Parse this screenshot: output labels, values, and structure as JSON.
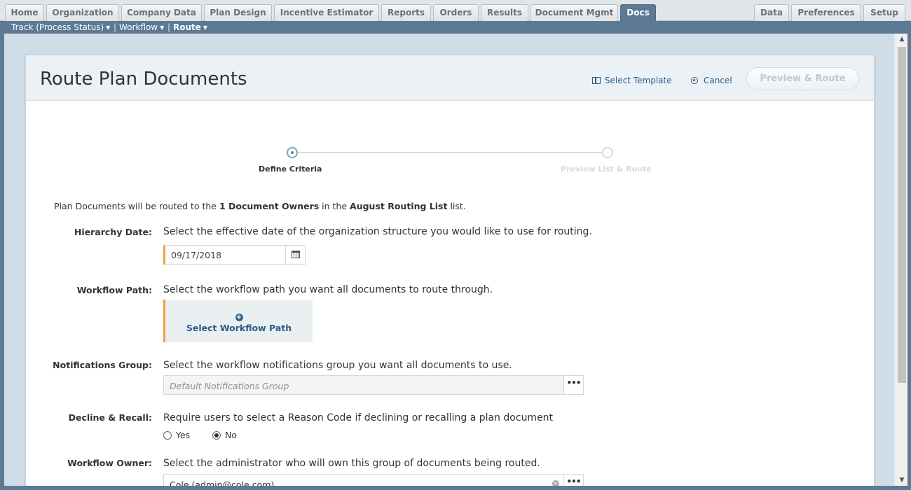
{
  "tabs_left": [
    {
      "label": "Home"
    },
    {
      "label": "Organization"
    },
    {
      "label": "Company Data"
    },
    {
      "label": "Plan Design"
    },
    {
      "label": "Incentive Estimator"
    },
    {
      "label": "Reports"
    },
    {
      "label": "Orders"
    },
    {
      "label": "Results"
    },
    {
      "label": "Document Mgmt"
    },
    {
      "label": "Docs"
    }
  ],
  "tabs_right": [
    {
      "label": "Data"
    },
    {
      "label": "Preferences"
    },
    {
      "label": "Setup"
    }
  ],
  "active_tab": "Docs",
  "subnav": {
    "track": "Track (Process Status)",
    "workflow": "Workflow",
    "route": "Route",
    "separator": "|"
  },
  "header": {
    "title": "Route Plan Documents",
    "select_template": "Select Template",
    "cancel": "Cancel",
    "preview_route": "Preview & Route"
  },
  "stepper": {
    "step1": "Define Criteria",
    "step2": "Preview List & Route"
  },
  "intro": {
    "prefix": "Plan Documents will be routed to the ",
    "owners": "1 Document Owners",
    "middle": " in the ",
    "list": "August Routing List",
    "suffix": " list."
  },
  "hierarchy": {
    "label": "Hierarchy Date:",
    "description": "Select the effective date of the organization structure you would like to use for routing.",
    "value": "09/17/2018"
  },
  "workflow_path": {
    "label": "Workflow Path:",
    "description": "Select the workflow path you want all documents to route through.",
    "button": "Select Workflow Path"
  },
  "notifications": {
    "label": "Notifications Group:",
    "description": "Select the workflow notifications group you want all documents to use.",
    "placeholder": "Default Notifications Group"
  },
  "decline": {
    "label": "Decline & Recall:",
    "description": "Require users to select a Reason Code if declining or recalling a plan document",
    "yes": "Yes",
    "no": "No",
    "selected": "No"
  },
  "workflow_owner": {
    "label": "Workflow Owner:",
    "description": "Select the administrator who will own this group of documents being routed.",
    "value": "Cole (admin@cole.com)"
  },
  "colors": {
    "nav_bar": "#5c7a93",
    "accent_required": "#f0a33a",
    "link": "#2d5c88",
    "workspace_bg": "#cfdde8"
  }
}
